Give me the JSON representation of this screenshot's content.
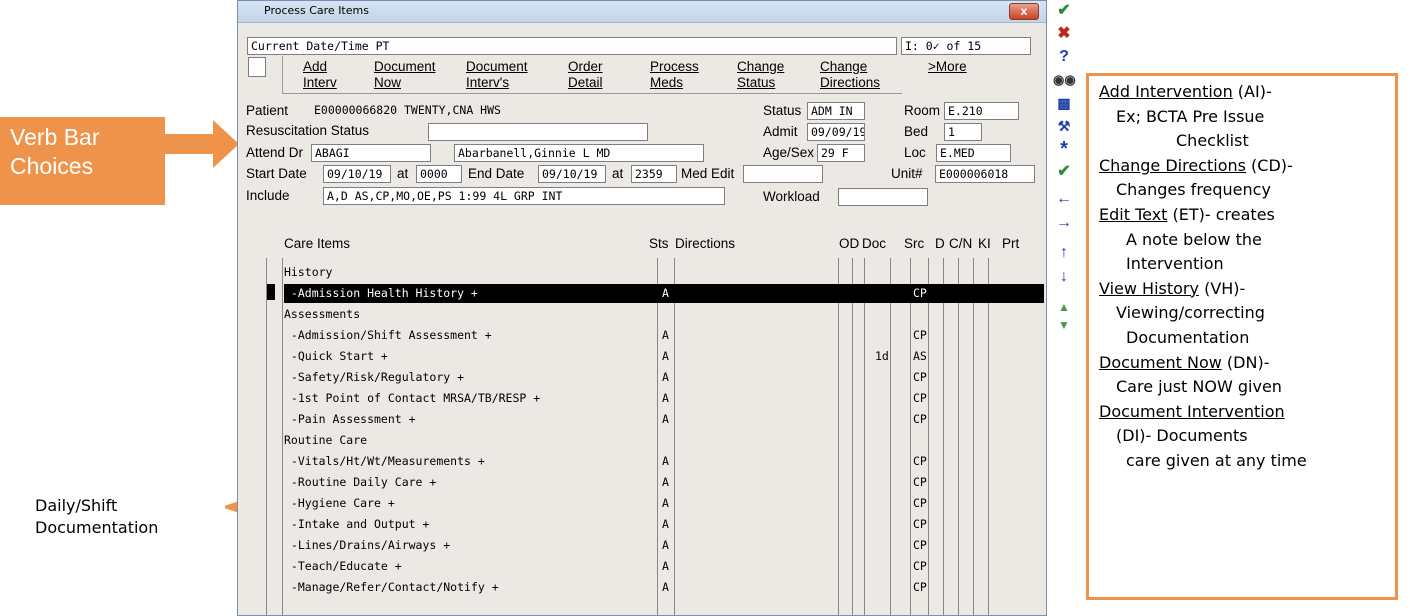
{
  "window": {
    "title": "Process Care Items",
    "close_label": "x"
  },
  "header": {
    "current_datetime": "Current Date/Time PT",
    "counter": "I: 0✓ of 15"
  },
  "verbs": [
    {
      "line1": "Add",
      "line2": "Interv"
    },
    {
      "line1": "Document",
      "line2": "Now"
    },
    {
      "line1": "Document",
      "line2": "Interv's"
    },
    {
      "line1": "Order",
      "line2": "Detail"
    },
    {
      "line1": "Process",
      "line2": "Meds"
    },
    {
      "line1": "Change",
      "line2": "Status"
    },
    {
      "line1": "Change",
      "line2": "Directions"
    },
    {
      "line1": ">More",
      "line2": ""
    }
  ],
  "patient": {
    "patient_label": "Patient",
    "patient_value": "E00000066820 TWENTY,CNA HWS",
    "status_label": "Status",
    "status_value": "ADM IN",
    "room_label": "Room",
    "room_value": "E.210",
    "resus_label": "Resuscitation Status",
    "resus_value": "",
    "admit_label": "Admit",
    "admit_value": "09/09/19",
    "bed_label": "Bed",
    "bed_value": "1",
    "attend_label": "Attend Dr",
    "attend_code": "ABAGI",
    "attend_name": "Abarbanell,Ginnie L  MD",
    "agesex_label": "Age/Sex",
    "agesex_value": "29 F",
    "loc_label": "Loc",
    "loc_value": "E.MED",
    "start_label": "Start Date",
    "start_date": "09/10/19",
    "at1": "at",
    "start_time": "0000",
    "end_label": "End Date",
    "end_date": "09/10/19",
    "at2": "at",
    "end_time": "2359",
    "medit_label": "Med Edit",
    "medit_value": "",
    "unit_label": "Unit#",
    "unit_value": "E000006018",
    "include_label": "Include",
    "include_value": "A,D AS,CP,MO,OE,PS 1:99 4L GRP INT",
    "workload_label": "Workload",
    "workload_value": ""
  },
  "columns": {
    "care_items": "Care Items",
    "sts": "Sts",
    "directions": "Directions",
    "od": "OD",
    "doc": "Doc",
    "src": "Src",
    "d": "D",
    "cn": "C/N",
    "ki": "KI",
    "prt": "Prt"
  },
  "rows": [
    {
      "name": "History",
      "sts": "",
      "doc": "",
      "src": ""
    },
    {
      "name": " -Admission Health History +",
      "sts": "A",
      "doc": "",
      "src": "CP"
    },
    {
      "name": "Assessments",
      "sts": "",
      "doc": "",
      "src": ""
    },
    {
      "name": " -Admission/Shift Assessment +",
      "sts": "A",
      "doc": "",
      "src": "CP"
    },
    {
      "name": " -Quick Start +",
      "sts": "A",
      "doc": "1d",
      "src": "AS"
    },
    {
      "name": " -Safety/Risk/Regulatory +",
      "sts": "A",
      "doc": "",
      "src": "CP"
    },
    {
      "name": " -1st Point of Contact MRSA/TB/RESP +",
      "sts": "A",
      "doc": "",
      "src": "CP"
    },
    {
      "name": " -Pain Assessment +",
      "sts": "A",
      "doc": "",
      "src": "CP"
    },
    {
      "name": "Routine Care",
      "sts": "",
      "doc": "",
      "src": ""
    },
    {
      "name": " -Vitals/Ht/Wt/Measurements +",
      "sts": "A",
      "doc": "",
      "src": "CP"
    },
    {
      "name": " -Routine Daily Care +",
      "sts": "A",
      "doc": "",
      "src": "CP"
    },
    {
      "name": " -Hygiene Care +",
      "sts": "A",
      "doc": "",
      "src": "CP"
    },
    {
      "name": " -Intake and Output +",
      "sts": "A",
      "doc": "",
      "src": "CP"
    },
    {
      "name": " -Lines/Drains/Airways +",
      "sts": "A",
      "doc": "",
      "src": "CP"
    },
    {
      "name": " -Teach/Educate +",
      "sts": "A",
      "doc": "",
      "src": "CP"
    },
    {
      "name": " -Manage/Refer/Contact/Notify +",
      "sts": "A",
      "doc": "",
      "src": "CP"
    }
  ],
  "callouts": {
    "verb_bar_line1": "Verb Bar",
    "verb_bar_line2": "Choices",
    "daily_line1": "Daily/Shift",
    "daily_line2": "Documentation"
  },
  "info": [
    {
      "u": "Add Intervention",
      "t": " (AI)-"
    },
    {
      "u": "",
      "t": "Ex; BCTA Pre Issue"
    },
    {
      "u": "",
      "t": "Checklist"
    },
    {
      "u": "Change Directions",
      "t": " (CD)-"
    },
    {
      "u": "",
      "t": "Changes frequency"
    },
    {
      "u": "Edit Text",
      "t": " (ET)- creates"
    },
    {
      "u": "",
      "t": "A note below the"
    },
    {
      "u": "",
      "t": "Intervention"
    },
    {
      "u": "View History",
      "t": " (VH)-"
    },
    {
      "u": "",
      "t": "Viewing/correcting"
    },
    {
      "u": "",
      "t": "Documentation"
    },
    {
      "u": "Document Now",
      "t": " (DN)-"
    },
    {
      "u": "",
      "t": "Care just NOW given"
    },
    {
      "u": "Document Intervention",
      "t": ""
    },
    {
      "u": "",
      "t": "(DI)- Documents"
    },
    {
      "u": "",
      "t": "care given at any time"
    }
  ],
  "toolbar_icons": [
    "check-icon",
    "x-icon",
    "help-icon",
    "binoculars-icon",
    "print-icon",
    "tools-icon",
    "asterisk-icon",
    "check-all-icon",
    "arrow-left-icon",
    "arrow-right-icon",
    "arrow-up-icon",
    "arrow-down-icon",
    "page-up-icon",
    "page-down-icon"
  ],
  "colors": {
    "accent": "#f0934a",
    "selected_row": "#000000",
    "toolbar_blue": "#1f3fa8",
    "toolbar_green": "#2e8b2e",
    "toolbar_red": "#c0281b"
  }
}
